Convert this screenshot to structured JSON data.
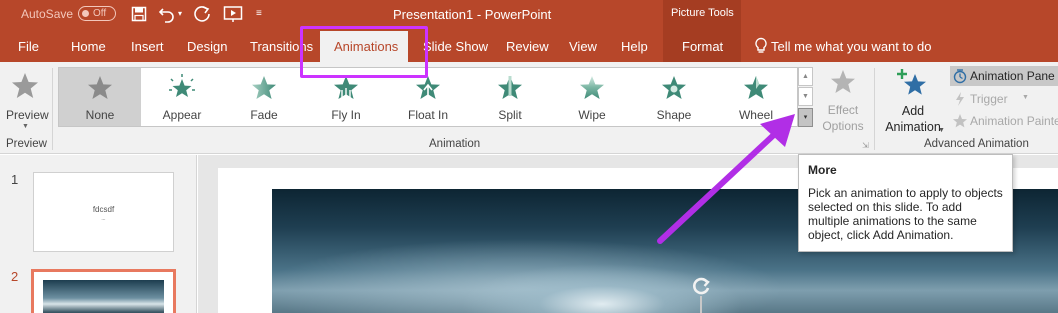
{
  "titlebar": {
    "autosave_label": "AutoSave",
    "autosave_state": "Off",
    "document_title": "Presentation1  -  PowerPoint",
    "contextual_group": "Picture Tools",
    "bg_color": "#b7472a"
  },
  "tabs": {
    "file": "File",
    "home": "Home",
    "insert": "Insert",
    "design": "Design",
    "transitions": "Transitions",
    "animations": "Animations",
    "slideshow": "Slide Show",
    "review": "Review",
    "view": "View",
    "help": "Help",
    "format": "Format",
    "tell_me": "Tell me what you want to do"
  },
  "ribbon": {
    "preview": {
      "label": "Preview",
      "group": "Preview"
    },
    "animation_group": "Animation",
    "gallery": [
      {
        "label": "None",
        "icon": "none-star-icon",
        "selected": true
      },
      {
        "label": "Appear",
        "icon": "appear-star-icon"
      },
      {
        "label": "Fade",
        "icon": "fade-star-icon"
      },
      {
        "label": "Fly In",
        "icon": "fly-in-star-icon"
      },
      {
        "label": "Float In",
        "icon": "float-in-star-icon"
      },
      {
        "label": "Split",
        "icon": "split-star-icon"
      },
      {
        "label": "Wipe",
        "icon": "wipe-star-icon"
      },
      {
        "label": "Shape",
        "icon": "shape-star-icon"
      },
      {
        "label": "Wheel",
        "icon": "wheel-star-icon"
      }
    ],
    "effect_options": {
      "line1": "Effect",
      "line2": "Options"
    },
    "add_animation": {
      "line1": "Add",
      "line2": "Animation"
    },
    "advanced_group": "Advanced Animation",
    "animation_pane": "Animation Pane",
    "trigger": "Trigger",
    "animation_painter": "Animation Painter"
  },
  "slides": {
    "slide1_number": "1",
    "slide1_text": "fdcsdf",
    "slide1_subtext": "...",
    "slide2_number": "2"
  },
  "tooltip": {
    "title": "More",
    "body": "Pick an animation to apply to objects selected on this slide.  To add multiple animations to the same object, click Add Animation."
  },
  "colors": {
    "accent": "#b7472a",
    "highlight": "#cc33ff",
    "animation_star": "#3f8a77",
    "selected_slide_border": "#e8795f"
  }
}
